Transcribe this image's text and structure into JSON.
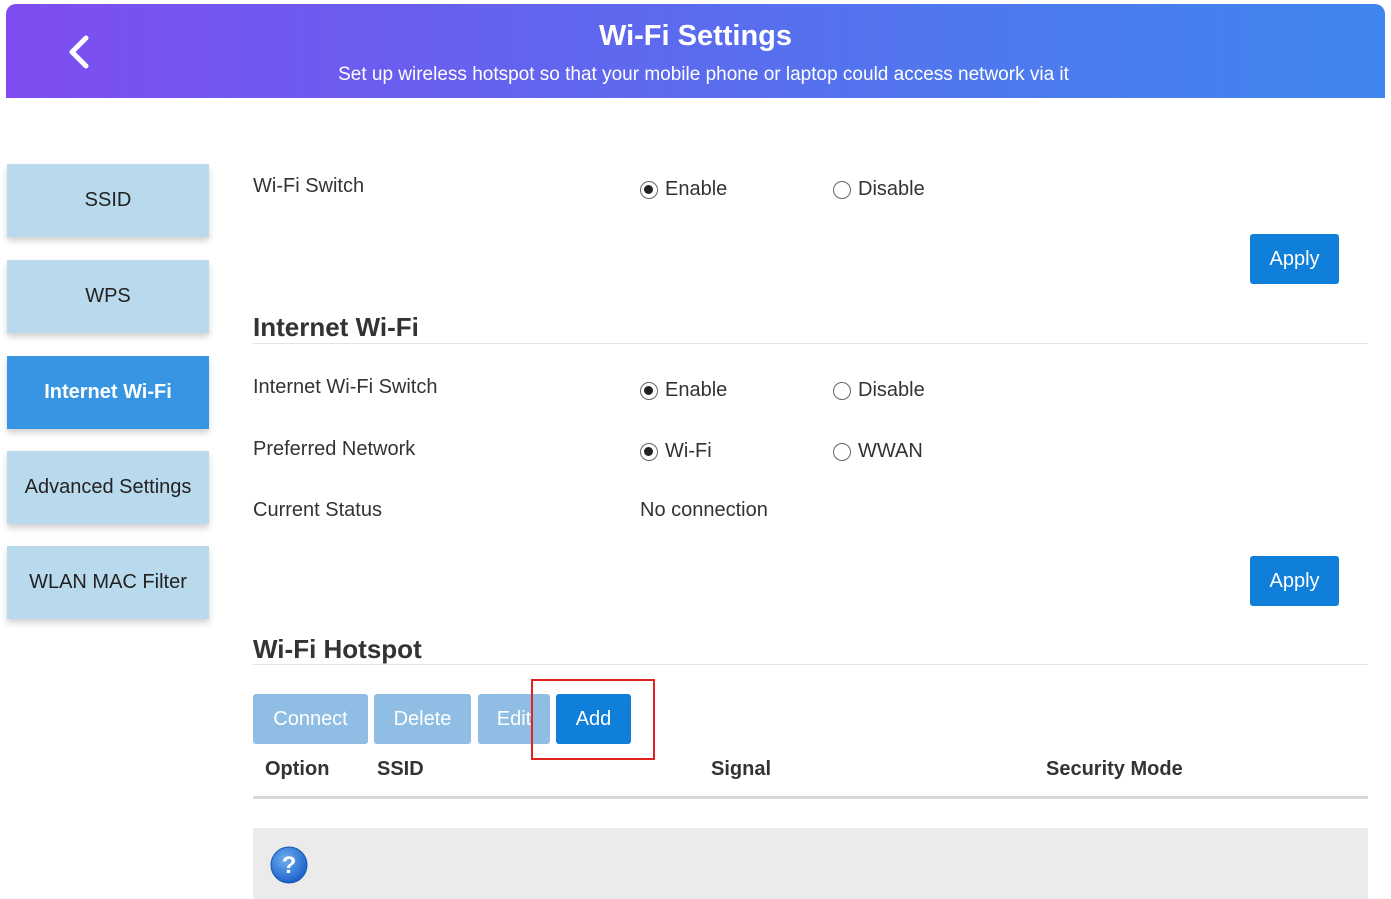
{
  "header": {
    "title": "Wi-Fi Settings",
    "subtitle": "Set up wireless hotspot so that your mobile phone or laptop could access network via it",
    "back_icon": "chevron-left-icon",
    "gradient_colors": [
      "#7f4cf0",
      "#3f86ee"
    ]
  },
  "sidebar": {
    "items": [
      {
        "label": "SSID",
        "active": false
      },
      {
        "label": "WPS",
        "active": false
      },
      {
        "label": "Internet Wi-Fi",
        "active": true
      },
      {
        "label": "Advanced Settings",
        "active": false
      },
      {
        "label": "WLAN MAC Filter",
        "active": false
      }
    ],
    "active_color": "#3895e3",
    "inactive_color": "#b9d9ed"
  },
  "wifi_switch": {
    "label": "Wi-Fi Switch",
    "options": [
      "Enable",
      "Disable"
    ],
    "selected": "Enable",
    "apply_label": "Apply"
  },
  "internet_wifi": {
    "title": "Internet Wi-Fi",
    "switch_label": "Internet Wi-Fi Switch",
    "switch_options": [
      "Enable",
      "Disable"
    ],
    "switch_selected": "Enable",
    "preferred_label": "Preferred Network",
    "preferred_options": [
      "Wi-Fi",
      "WWAN"
    ],
    "preferred_selected": "Wi-Fi",
    "status_label": "Current Status",
    "status_value": "No connection",
    "apply_label": "Apply"
  },
  "hotspot": {
    "title": "Wi-Fi Hotspot",
    "buttons": {
      "connect": "Connect",
      "delete": "Delete",
      "edit": "Edit",
      "add": "Add"
    },
    "columns": [
      "Option",
      "SSID",
      "Signal",
      "Security Mode"
    ],
    "help_icon": "question-mark-icon"
  },
  "colors": {
    "primary_button": "#0f7fd9",
    "disabled_button": "#8fbde3",
    "highlight_box": "#e32222"
  }
}
